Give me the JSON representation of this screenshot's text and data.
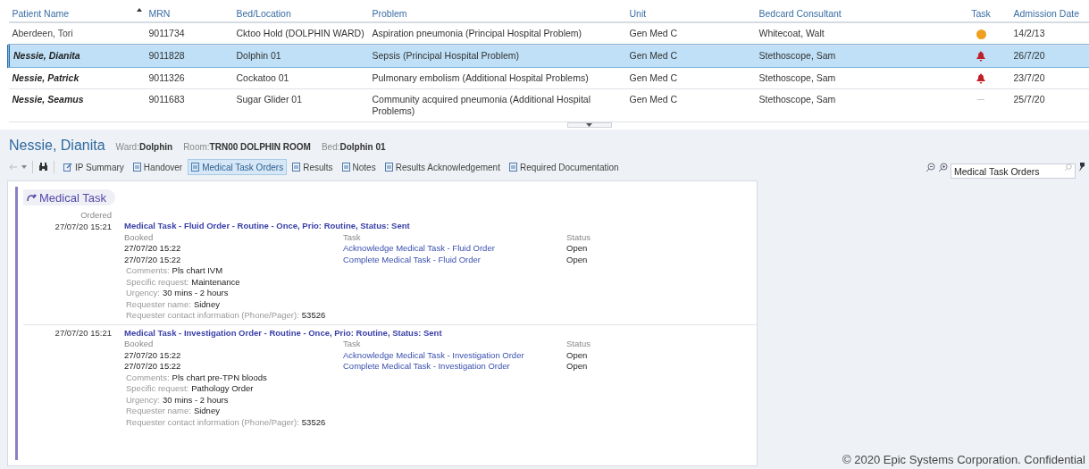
{
  "patient_list": {
    "columns": [
      {
        "label": "Patient Name",
        "sorted": true
      },
      {
        "label": "MRN",
        "sorted": false
      },
      {
        "label": "Bed/Location",
        "sorted": false
      },
      {
        "label": "Problem",
        "sorted": false
      },
      {
        "label": "Unit",
        "sorted": false
      },
      {
        "label": "Bedcard Consultant",
        "sorted": false
      },
      {
        "label": "Task",
        "sorted": false
      },
      {
        "label": "Admission Date",
        "sorted": false
      }
    ],
    "rows": [
      {
        "name": "Aberdeen, Tori",
        "emphasized": false,
        "selected": false,
        "mrn": "9011734",
        "bed": "Cktoo Hold (DOLPHIN WARD)",
        "problem": "Aspiration pneumonia (Principal Hospital Problem)",
        "unit": "Gen Med C",
        "consultant": "Whitecoat, Walt",
        "task": {
          "kind": "dot",
          "color": "#f0a020"
        },
        "admission_date": "14/2/13"
      },
      {
        "name": "Nessie, Dianita",
        "emphasized": true,
        "selected": true,
        "mrn": "9011828",
        "bed": "Dolphin 01",
        "problem": "Sepsis (Principal Hospital Problem)",
        "unit": "Gen Med C",
        "consultant": "Stethoscope, Sam",
        "task": {
          "kind": "bell",
          "color": "#c0202a"
        },
        "admission_date": "26/7/20"
      },
      {
        "name": "Nessie, Patrick",
        "emphasized": true,
        "selected": false,
        "mrn": "9011326",
        "bed": "Cockatoo 01",
        "problem": "Pulmonary embolism (Additional Hospital Problems)",
        "unit": "Gen Med C",
        "consultant": "Stethoscope, Sam",
        "task": {
          "kind": "bell",
          "color": "#c0202a"
        },
        "admission_date": "23/7/20"
      },
      {
        "name": "Nessie, Seamus",
        "emphasized": true,
        "selected": false,
        "mrn": "9011683",
        "bed": "Sugar Glider 01",
        "problem": "Community acquired pneumonia (Additional Hospital Problems)",
        "unit": "Gen Med C",
        "consultant": "Stethoscope, Sam",
        "task": {
          "kind": "dash",
          "color": "#c8c8c8"
        },
        "admission_date": "25/7/20"
      }
    ]
  },
  "patient_header": {
    "name": "Nessie, Dianita",
    "fields": [
      {
        "label": "Ward:",
        "value": "Dolphin"
      },
      {
        "label": "Room:",
        "value": "TRN00 DOLPHIN ROOM"
      },
      {
        "label": "Bed:",
        "value": "Dolphin 01"
      }
    ]
  },
  "tabs": [
    {
      "label": "IP Summary",
      "kind": "summary",
      "selected": false
    },
    {
      "label": "Handover",
      "kind": "doc",
      "selected": false
    },
    {
      "label": "Medical Task Orders",
      "kind": "doc",
      "selected": true
    },
    {
      "label": "Results",
      "kind": "doc",
      "selected": false
    },
    {
      "label": "Notes",
      "kind": "doc",
      "selected": false
    },
    {
      "label": "Results Acknowledgement",
      "kind": "doc",
      "selected": false
    },
    {
      "label": "Required Documentation",
      "kind": "doc",
      "selected": false
    }
  ],
  "search": {
    "value": "Medical Task Orders"
  },
  "report": {
    "title": "Medical Task",
    "ordered_label": "Ordered",
    "orders": [
      {
        "ordered": "27/07/20 15:21",
        "title": "Medical Task - Fluid Order - Routine - Once, Prio: Routine, Status: Sent",
        "booked_label": "Booked",
        "task_label": "Task",
        "status_label": "Status",
        "tasks": [
          {
            "booked": "27/07/20 15:22",
            "task": "Acknowledge Medical Task - Fluid Order",
            "status": "Open"
          },
          {
            "booked": "27/07/20 15:22",
            "task": "Complete Medical Task - Fluid Order",
            "status": "Open"
          }
        ],
        "details": [
          {
            "label": "Comments:",
            "value": "Pls chart IVM"
          },
          {
            "label": "Specific request:",
            "value": "Maintenance"
          },
          {
            "label": "Urgency:",
            "value": "30 mins - 2 hours"
          },
          {
            "label": "Requester name:",
            "value": "Sidney"
          },
          {
            "label": "Requester contact information (Phone/Pager):",
            "value": "53526"
          }
        ]
      },
      {
        "ordered": "27/07/20 15:21",
        "title": "Medical Task - Investigation Order - Routine - Once, Prio: Routine, Status: Sent",
        "booked_label": "Booked",
        "task_label": "Task",
        "status_label": "Status",
        "tasks": [
          {
            "booked": "27/07/20 15:22",
            "task": "Acknowledge Medical Task - Investigation Order",
            "status": "Open"
          },
          {
            "booked": "27/07/20 15:22",
            "task": "Complete Medical Task - Investigation Order",
            "status": "Open"
          }
        ],
        "details": [
          {
            "label": "Comments:",
            "value": "Pls chart pre-TPN bloods"
          },
          {
            "label": "Specific request:",
            "value": "Pathology Order"
          },
          {
            "label": "Urgency:",
            "value": "30 mins - 2 hours"
          },
          {
            "label": "Requester name:",
            "value": "Sidney"
          },
          {
            "label": "Requester contact information (Phone/Pager):",
            "value": "53526"
          }
        ]
      }
    ]
  },
  "footer": "© 2020 Epic Systems Corporation. Confidential"
}
